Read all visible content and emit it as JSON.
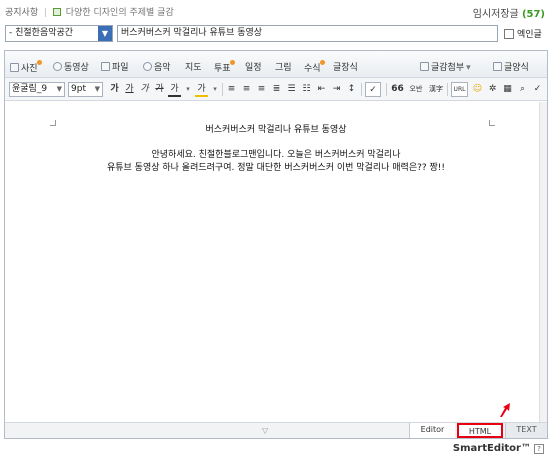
{
  "topbar": {
    "notice": "공지사항",
    "tip": "다양한 디자인의 주제별 글감",
    "save_label": "임시저장글",
    "save_count": "(57)"
  },
  "post": {
    "category": "- 친절한음악공간",
    "title": "버스커버스커 막걸리나 유튜브 동영상",
    "secret_label": "엑인글"
  },
  "toolbar1": {
    "items": [
      "사진",
      "동영상",
      "파일",
      "음악",
      "지도",
      "투표",
      "일정",
      "그림",
      "수식",
      "글장식"
    ],
    "template": "글감첨부",
    "layout": "글양식"
  },
  "toolbar2": {
    "font": "윤굴림_9",
    "size": "9pt",
    "bold": "가",
    "underline": "가",
    "italic": "가",
    "strike": "가",
    "color": "가",
    "bg": "가",
    "quote": "66",
    "symbol": "오반",
    "hanja": "漢字",
    "url": "URL"
  },
  "content": {
    "heading": "버스커버스커 막걸리나 유튜브 동영상",
    "line1": "안녕하세요. 친절한블로그맨입니다. 오늘은 버스커버스커 막걸리나",
    "line2": "유튜브 동영상 하나 올려드려구여. 정말 대단한 버스커버스커 이번 막걸리나 매력은?? 짱!!"
  },
  "tabs": {
    "editor": "Editor",
    "html": "HTML",
    "text": "TEXT"
  },
  "brand": "SmartEditor™",
  "colors": {
    "accent": "#3b6fb5",
    "save_count": "#3a9a24",
    "highlight": "#e60012"
  }
}
